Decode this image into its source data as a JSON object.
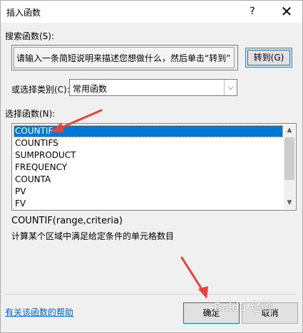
{
  "window": {
    "title": "插入函数",
    "help_glyph": "?",
    "close_glyph": "✕"
  },
  "search": {
    "label": "搜索函数(S):",
    "value": "请输入一条简短说明来描述您想做什么，然后单击“转到”",
    "goto_label": "转到(G)"
  },
  "category": {
    "label": "或选择类别(C):",
    "selected": "常用函数",
    "arrow_glyph": "⌵"
  },
  "functions": {
    "label": "选择函数(N):",
    "items": [
      "COUNTIF",
      "COUNTIFS",
      "SUMPRODUCT",
      "FREQUENCY",
      "COUNTA",
      "PV",
      "FV"
    ],
    "selected_index": 0,
    "scroll_up_glyph": "▲",
    "scroll_down_glyph": "▼"
  },
  "description": {
    "signature": "COUNTIF(range,criteria)",
    "text": "计算某个区域中满足给定条件的单元格数目"
  },
  "footer": {
    "help_link": "有关该函数的帮助",
    "ok_label": "确定",
    "cancel_label": "取消"
  },
  "annotations": {
    "arrow_color": "#e8433a"
  },
  "watermark": {
    "text": "Baidu 经验"
  }
}
